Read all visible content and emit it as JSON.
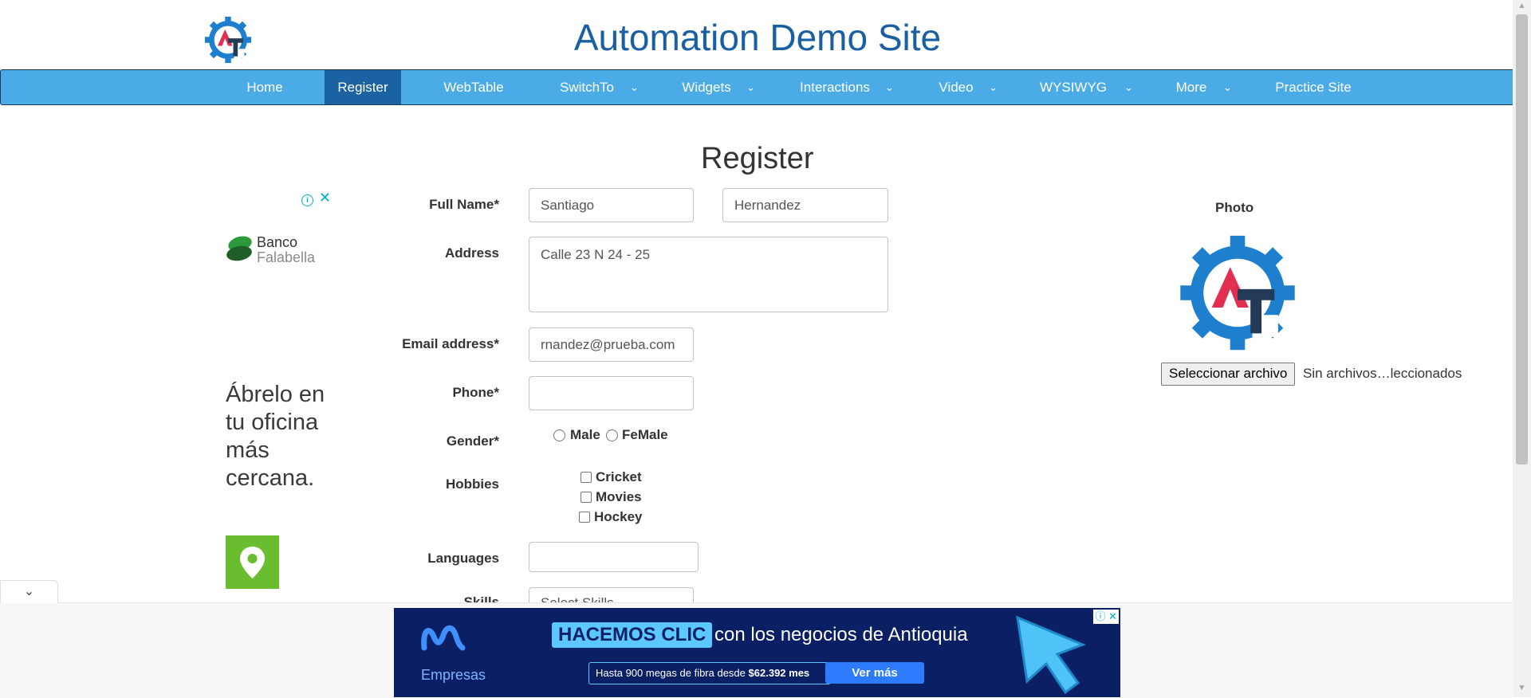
{
  "header": {
    "site_title": "Automation Demo Site"
  },
  "nav": {
    "items": [
      {
        "label": "Home"
      },
      {
        "label": "Register"
      },
      {
        "label": "WebTable"
      },
      {
        "label": "SwitchTo"
      },
      {
        "label": "Widgets"
      },
      {
        "label": "Interactions"
      },
      {
        "label": "Video"
      },
      {
        "label": "WYSIWYG"
      },
      {
        "label": "More"
      },
      {
        "label": "Practice Site"
      }
    ],
    "active": "Register",
    "chevron_icon": "chevron-down-icon"
  },
  "form": {
    "heading": "Register",
    "full_name_label": "Full Name*",
    "first_name_value": "Santiago",
    "last_name_value": "Hernandez",
    "address_label": "Address",
    "address_value": "Calle 23 N 24 - 25",
    "email_label": "Email address*",
    "email_value": "rnandez@prueba.com",
    "phone_label": "Phone*",
    "phone_value": "",
    "gender_label": "Gender*",
    "gender_options": [
      "Male",
      "FeMale"
    ],
    "hobbies_label": "Hobbies",
    "hobbies_options": [
      "Cricket",
      "Movies",
      "Hockey"
    ],
    "languages_label": "Languages",
    "languages_value": "",
    "skills_label": "Skills",
    "skills_placeholder": "Select Skills"
  },
  "photo": {
    "label": "Photo",
    "file_button_label": "Seleccionar archivo",
    "file_status": "Sin archivos…leccionados"
  },
  "left_ad": {
    "brand_line1": "Banco",
    "brand_line2": "Falabella",
    "copy": "Ábrelo en tu oficina más cercana.",
    "info_icon": "info-icon",
    "close_icon": "close-icon"
  },
  "bottom_ad": {
    "brand": "Empresas",
    "headline_highlight": "HACEMOS CLIC",
    "headline_rest": "con los negocios de Antioquia",
    "offer_prefix": "Hasta 900 megas de fibra desde",
    "offer_price": "$62.392 mes",
    "cta": "Ver más"
  },
  "colors": {
    "navbar": "#4aabe6",
    "nav_active": "#1b62a3",
    "title": "#1a5fa3"
  }
}
